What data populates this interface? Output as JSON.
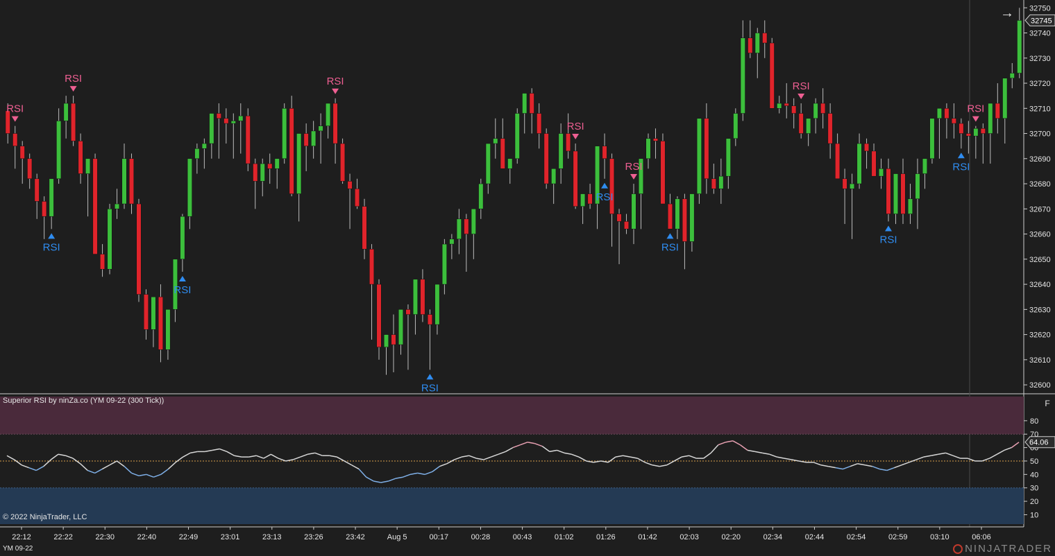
{
  "indicator_title": "Superior RSI by ninZa.co (YM 09-22 (300 Tick))",
  "copyright": "© 2022 NinjaTrader, LLC",
  "instrument": "YM 09-22",
  "brand": "NINJATRADER",
  "panel_button": "F",
  "arrow_icon": "→",
  "signal_label": "RSI",
  "colors": {
    "background": "#1e1e1e",
    "up_candle": "#3cbf3c",
    "down_candle": "#e0242b",
    "wick": "#bdbdbd",
    "buy_signal": "#2f8cf0",
    "sell_signal": "#ee5f92",
    "overbought_zone": "#4a2a3b",
    "oversold_zone": "#243a54",
    "midline": "#d9a04a"
  },
  "chart_data": [
    {
      "type": "candlestick",
      "y_ticks": [
        32750,
        32740,
        32730,
        32720,
        32710,
        32700,
        32690,
        32680,
        32670,
        32660,
        32650,
        32640,
        32630,
        32620,
        32610,
        32600
      ],
      "ylim": [
        32597,
        32752
      ],
      "x_tick_labels": [
        "22:12",
        "22:22",
        "22:30",
        "22:40",
        "22:49",
        "23:01",
        "23:13",
        "23:26",
        "23:42",
        "Aug 5",
        "00:17",
        "00:28",
        "00:43",
        "01:02",
        "01:26",
        "01:42",
        "02:03",
        "02:20",
        "02:34",
        "02:44",
        "02:54",
        "02:59",
        "03:10",
        "06:06"
      ],
      "last_price": "32745",
      "candles": [
        [
          32709,
          32712,
          32696,
          32700
        ],
        [
          32700,
          32703,
          32686,
          32695
        ],
        [
          32695,
          32697,
          32680,
          32690
        ],
        [
          32690,
          32692,
          32678,
          32682
        ],
        [
          32682,
          32684,
          32666,
          32673
        ],
        [
          32673,
          32675,
          32658,
          32667
        ],
        [
          32667,
          32678,
          32662,
          32682
        ],
        [
          32682,
          32710,
          32680,
          32705
        ],
        [
          32705,
          32715,
          32698,
          32712
        ],
        [
          32712,
          32715,
          32695,
          32697
        ],
        [
          32697,
          32700,
          32680,
          32684
        ],
        [
          32684,
          32686,
          32667,
          32690
        ],
        [
          32690,
          32692,
          32660,
          32652
        ],
        [
          32652,
          32656,
          32643,
          32646
        ],
        [
          32646,
          32672,
          32644,
          32670
        ],
        [
          32670,
          32678,
          32666,
          32672
        ],
        [
          32672,
          32696,
          32670,
          32690
        ],
        [
          32690,
          32692,
          32668,
          32672
        ],
        [
          32672,
          32674,
          32633,
          32636
        ],
        [
          32636,
          32638,
          32618,
          32622
        ],
        [
          32622,
          32635,
          32615,
          32635
        ],
        [
          32635,
          32640,
          32609,
          32614
        ],
        [
          32614,
          32630,
          32610,
          32630
        ],
        [
          32630,
          32648,
          32625,
          32650
        ],
        [
          32650,
          32668,
          32645,
          32667
        ],
        [
          32667,
          32680,
          32662,
          32690
        ],
        [
          32690,
          32696,
          32684,
          32694
        ],
        [
          32694,
          32698,
          32686,
          32696
        ],
        [
          32696,
          32705,
          32690,
          32708
        ],
        [
          32708,
          32712,
          32690,
          32706
        ],
        [
          32706,
          32710,
          32696,
          32704
        ],
        [
          32704,
          32708,
          32690,
          32705
        ],
        [
          32705,
          32712,
          32692,
          32707
        ],
        [
          32707,
          32710,
          32685,
          32688
        ],
        [
          32688,
          32690,
          32670,
          32681
        ],
        [
          32681,
          32690,
          32675,
          32688
        ],
        [
          32688,
          32692,
          32680,
          32686
        ],
        [
          32686,
          32690,
          32678,
          32690
        ],
        [
          32690,
          32712,
          32688,
          32710
        ],
        [
          32710,
          32715,
          32675,
          32676
        ],
        [
          32676,
          32680,
          32665,
          32700
        ],
        [
          32700,
          32704,
          32685,
          32695
        ],
        [
          32695,
          32705,
          32690,
          32701
        ],
        [
          32701,
          32708,
          32688,
          32703
        ],
        [
          32703,
          32712,
          32698,
          32712
        ],
        [
          32712,
          32714,
          32688,
          32696
        ],
        [
          32696,
          32698,
          32680,
          32681
        ],
        [
          32681,
          32684,
          32662,
          32678
        ],
        [
          32678,
          32682,
          32670,
          32671
        ],
        [
          32671,
          32674,
          32650,
          32654
        ],
        [
          32654,
          32656,
          32618,
          32640
        ],
        [
          32640,
          32642,
          32610,
          32615
        ],
        [
          32615,
          32620,
          32604,
          32620
        ],
        [
          32620,
          32628,
          32605,
          32616
        ],
        [
          32616,
          32630,
          32612,
          32630
        ],
        [
          32630,
          32632,
          32606,
          32628
        ],
        [
          32628,
          32638,
          32620,
          32642
        ],
        [
          32642,
          32646,
          32625,
          32628
        ],
        [
          32628,
          32630,
          32606,
          32624
        ],
        [
          32624,
          32640,
          32620,
          32640
        ],
        [
          32640,
          32658,
          32636,
          32656
        ],
        [
          32656,
          32660,
          32650,
          32658
        ],
        [
          32658,
          32670,
          32652,
          32666
        ],
        [
          32666,
          32668,
          32645,
          32660
        ],
        [
          32660,
          32666,
          32650,
          32670
        ],
        [
          32670,
          32682,
          32666,
          32680
        ],
        [
          32680,
          32688,
          32676,
          32696
        ],
        [
          32696,
          32706,
          32690,
          32698
        ],
        [
          32698,
          32706,
          32690,
          32686
        ],
        [
          32686,
          32690,
          32680,
          32690
        ],
        [
          32690,
          32710,
          32688,
          32708
        ],
        [
          32708,
          32714,
          32700,
          32716
        ],
        [
          32716,
          32718,
          32700,
          32708
        ],
        [
          32708,
          32712,
          32694,
          32700
        ],
        [
          32700,
          32702,
          32678,
          32680
        ],
        [
          32680,
          32686,
          32672,
          32686
        ],
        [
          32686,
          32704,
          32680,
          32700
        ],
        [
          32700,
          32708,
          32690,
          32693
        ],
        [
          32693,
          32696,
          32670,
          32671
        ],
        [
          32671,
          32676,
          32664,
          32676
        ],
        [
          32676,
          32680,
          32670,
          32672
        ],
        [
          32672,
          32675,
          32662,
          32695
        ],
        [
          32695,
          32700,
          32682,
          32690
        ],
        [
          32690,
          32692,
          32655,
          32668
        ],
        [
          32668,
          32670,
          32648,
          32665
        ],
        [
          32665,
          32668,
          32660,
          32662
        ],
        [
          32662,
          32680,
          32656,
          32676
        ],
        [
          32676,
          32682,
          32662,
          32690
        ],
        [
          32690,
          32700,
          32686,
          32698
        ],
        [
          32698,
          32702,
          32690,
          32697
        ],
        [
          32697,
          32700,
          32676,
          32672
        ],
        [
          32672,
          32676,
          32662,
          32662
        ],
        [
          32662,
          32675,
          32658,
          32674
        ],
        [
          32674,
          32676,
          32646,
          32657
        ],
        [
          32657,
          32666,
          32653,
          32676
        ],
        [
          32676,
          32688,
          32672,
          32706
        ],
        [
          32706,
          32712,
          32676,
          32682
        ],
        [
          32682,
          32688,
          32676,
          32678
        ],
        [
          32678,
          32690,
          32672,
          32683
        ],
        [
          32683,
          32696,
          32678,
          32698
        ],
        [
          32698,
          32710,
          32695,
          32708
        ],
        [
          32708,
          32745,
          32705,
          32738
        ],
        [
          32738,
          32745,
          32730,
          32732
        ],
        [
          32732,
          32742,
          32722,
          32740
        ],
        [
          32740,
          32745,
          32730,
          32736
        ],
        [
          32736,
          32738,
          32710,
          32710
        ],
        [
          32710,
          32715,
          32708,
          32712
        ],
        [
          32712,
          32720,
          32706,
          32711
        ],
        [
          32711,
          32714,
          32702,
          32708
        ],
        [
          32708,
          32712,
          32698,
          32700
        ],
        [
          32700,
          32706,
          32695,
          32706
        ],
        [
          32706,
          32714,
          32700,
          32712
        ],
        [
          32712,
          32718,
          32702,
          32708
        ],
        [
          32708,
          32712,
          32690,
          32696
        ],
        [
          32696,
          32700,
          32682,
          32682
        ],
        [
          32682,
          32686,
          32664,
          32678
        ],
        [
          32678,
          32684,
          32658,
          32680
        ],
        [
          32680,
          32700,
          32678,
          32696
        ],
        [
          32696,
          32698,
          32686,
          32693
        ],
        [
          32693,
          32696,
          32684,
          32683
        ],
        [
          32683,
          32690,
          32678,
          32686
        ],
        [
          32686,
          32690,
          32665,
          32668
        ],
        [
          32668,
          32670,
          32664,
          32684
        ],
        [
          32684,
          32690,
          32664,
          32668
        ],
        [
          32668,
          32680,
          32664,
          32674
        ],
        [
          32674,
          32690,
          32662,
          32684
        ],
        [
          32684,
          32688,
          32678,
          32690
        ],
        [
          32690,
          32706,
          32688,
          32706
        ],
        [
          32706,
          32710,
          32690,
          32710
        ],
        [
          32710,
          32712,
          32698,
          32706
        ],
        [
          32706,
          32712,
          32698,
          32704
        ],
        [
          32704,
          32706,
          32694,
          32700
        ],
        [
          32700,
          32705,
          32692,
          32699
        ],
        [
          32699,
          32703,
          32690,
          32702
        ],
        [
          32702,
          32704,
          32688,
          32700
        ],
        [
          32700,
          32712,
          32688,
          32712
        ],
        [
          32712,
          32720,
          32700,
          32706
        ],
        [
          32706,
          32710,
          32696,
          32722
        ],
        [
          32722,
          32728,
          32718,
          32724
        ],
        [
          32724,
          32750,
          32722,
          32745
        ]
      ]
    },
    {
      "type": "line",
      "title": "Superior RSI by ninZa.co (YM 09-22 (300 Tick))",
      "y_ticks": [
        80,
        70,
        60,
        50,
        40,
        30,
        20,
        10
      ],
      "ylim": [
        3,
        98
      ],
      "overbought": 70,
      "oversold": 30,
      "midline": 50,
      "last_value": "64.06",
      "series": [
        {
          "values": [
            54,
            51,
            47,
            45,
            43,
            46,
            51,
            55,
            54,
            52,
            48,
            43,
            41,
            44,
            47,
            50,
            46,
            41,
            39,
            40,
            38,
            40,
            44,
            49,
            53,
            56,
            57,
            57,
            58,
            59,
            57,
            54,
            53,
            53,
            54,
            52,
            55,
            52,
            50,
            51,
            53,
            55,
            56,
            54,
            54,
            53,
            50,
            47,
            44,
            38,
            35,
            34,
            35,
            37,
            38,
            40,
            41,
            40,
            42,
            46,
            48,
            51,
            53,
            54,
            52,
            51,
            53,
            55,
            57,
            60,
            62,
            64,
            63,
            61,
            57,
            58,
            56,
            55,
            53,
            50,
            49,
            50,
            49,
            53,
            54,
            53,
            52,
            49,
            47,
            46,
            47,
            50,
            53,
            54,
            52,
            52,
            56,
            62,
            64,
            65,
            62,
            58,
            57,
            56,
            55,
            53,
            52,
            51,
            50,
            49,
            49,
            47,
            46,
            45,
            44,
            46,
            48,
            47,
            46,
            44,
            43,
            45,
            47,
            49,
            51,
            53,
            54,
            55,
            56,
            54,
            52,
            52,
            50,
            50,
            52,
            55,
            58,
            60,
            64
          ]
        }
      ]
    }
  ]
}
